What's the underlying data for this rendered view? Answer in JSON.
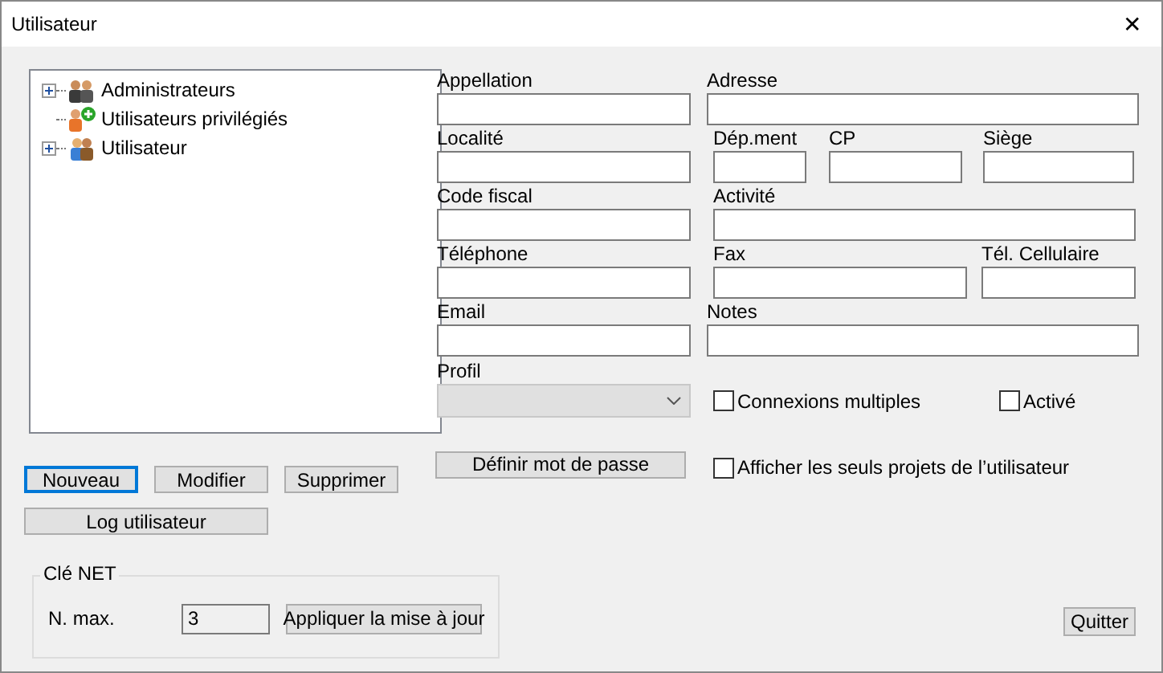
{
  "window": {
    "title": "Utilisateur",
    "close": "✕"
  },
  "tree": [
    {
      "label": "Administrateurs",
      "kind": "group",
      "expandable": true
    },
    {
      "label": "Utilisateurs privilégiés",
      "kind": "privileged",
      "expandable": false
    },
    {
      "label": "Utilisateur",
      "kind": "user",
      "expandable": true
    }
  ],
  "form_rows": [
    [
      {
        "label": "Appellation"
      },
      {
        "label": "Adresse"
      }
    ],
    [
      {
        "label": "Localité"
      },
      {
        "label": "Dép.ment"
      },
      {
        "label": "CP"
      },
      {
        "label": "Siège"
      }
    ],
    [
      {
        "label": "Code fiscal"
      },
      {
        "label": "Activité"
      }
    ],
    [
      {
        "label": "Téléphone"
      },
      {
        "label": "Fax"
      },
      {
        "label": "Tél. Cellulaire"
      }
    ],
    [
      {
        "label": "Email"
      },
      {
        "label": "Notes"
      }
    ]
  ],
  "profile": {
    "label": "Profil",
    "disabled": true
  },
  "checkboxes": [
    {
      "label": "Connexions multiples",
      "checked": false
    },
    {
      "label": "Activé",
      "checked": false
    }
  ],
  "buttons": [
    {
      "label": "Nouveau",
      "focused": true
    },
    {
      "label": "Modifier",
      "focused": false
    },
    {
      "label": "Supprimer",
      "focused": false
    }
  ],
  "password_button": "Définir mot de passe",
  "own_projects": {
    "label": "Afficher les seuls projets de l’utilisateur",
    "checked": false
  },
  "log_button": "Log utilisateur",
  "net_key": {
    "title": "Clé NET",
    "max_label": "N. max.",
    "max_value": "3",
    "apply_button": "Appliquer la mise à jour"
  },
  "quit_button": "Quitter"
}
